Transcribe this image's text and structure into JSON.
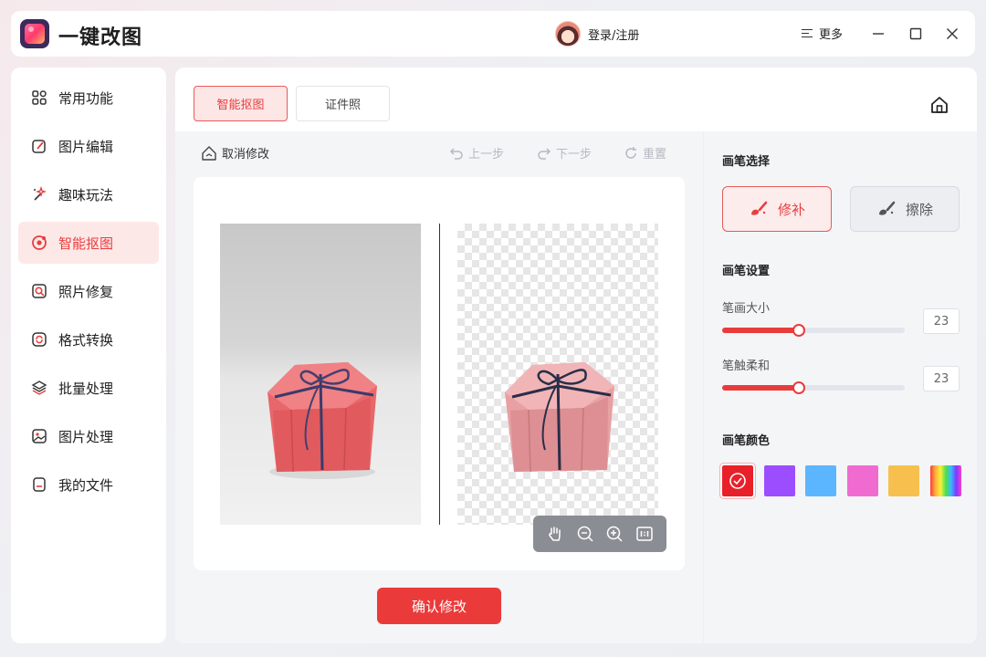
{
  "app": {
    "title": "一键改图"
  },
  "header": {
    "user_label": "登录/注册",
    "more_label": "更多"
  },
  "sidebar": {
    "items": [
      {
        "label": "常用功能",
        "icon": "grid-icon"
      },
      {
        "label": "图片编辑",
        "icon": "edit-icon"
      },
      {
        "label": "趣味玩法",
        "icon": "magic-wand-icon"
      },
      {
        "label": "智能抠图",
        "icon": "cutout-icon",
        "active": true
      },
      {
        "label": "照片修复",
        "icon": "photo-repair-icon"
      },
      {
        "label": "格式转换",
        "icon": "convert-icon"
      },
      {
        "label": "批量处理",
        "icon": "layers-icon"
      },
      {
        "label": "图片处理",
        "icon": "image-icon"
      },
      {
        "label": "我的文件",
        "icon": "file-icon"
      }
    ]
  },
  "main": {
    "tabs": [
      {
        "label": "智能抠图",
        "active": true
      },
      {
        "label": "证件照",
        "active": false
      }
    ],
    "toolbar": {
      "cancel": "取消修改",
      "undo": "上一步",
      "redo": "下一步",
      "reset": "重置"
    },
    "confirm_label": "确认修改"
  },
  "brush_panel": {
    "select_title": "画笔选择",
    "repair_label": "修补",
    "erase_label": "擦除",
    "settings_title": "画笔设置",
    "size_label": "笔画大小",
    "size_value": "23",
    "soft_label": "笔触柔和",
    "soft_value": "23",
    "size_fraction": 0.42,
    "soft_fraction": 0.42,
    "color_title": "画笔颜色",
    "colors": [
      "#e8202a",
      "#9b4dff",
      "#5cb6ff",
      "#f06bd0",
      "#f7c04e",
      "rainbow"
    ],
    "selected_color": "#e8202a"
  }
}
